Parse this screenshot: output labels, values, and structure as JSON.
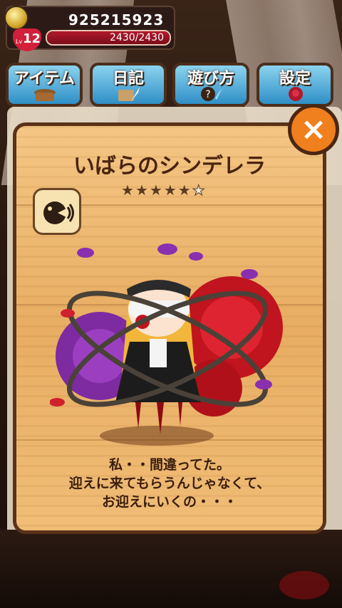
{
  "hud": {
    "coins": "925215923",
    "level_prefix": "Lv",
    "level": "12",
    "hp_text": "2430/2430",
    "hp_fraction": 1.0
  },
  "tabs": [
    {
      "label": "アイテム",
      "icon": "basket-icon"
    },
    {
      "label": "日記",
      "icon": "diary-quill-icon"
    },
    {
      "label": "遊び方",
      "icon": "question-icon"
    },
    {
      "label": "設定",
      "icon": "rose-icon"
    }
  ],
  "dialog": {
    "close_label": "×",
    "character_name": "いばらのシンデレラ",
    "rating": 5,
    "rating_max": 6,
    "voice_icon": "voice-speaker-icon",
    "quote_lines": [
      "私・・間違ってた。",
      "迎えに来てもらうんじゃなくて、",
      "お迎えにいくの・・・"
    ]
  },
  "colors": {
    "panel": "#f0bd77",
    "panel_border": "#5a3218",
    "close_button": "#f07f1e",
    "tab_blue": "#2f8fc6",
    "hp_fill": "#b0182d"
  }
}
